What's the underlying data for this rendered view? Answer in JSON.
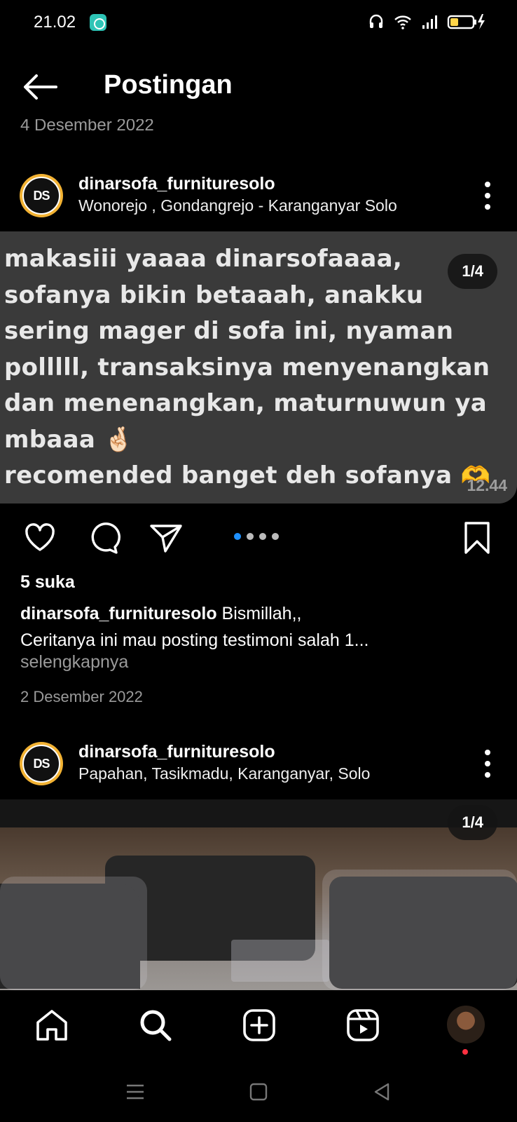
{
  "status_bar": {
    "time": "21.02"
  },
  "header": {
    "title": "Postingan"
  },
  "previous_post_date": "4 Desember 2022",
  "posts": [
    {
      "username": "dinarsofa_furnituresolo",
      "location": "Wonorejo , Gondangrejo - Karanganyar Solo",
      "avatar_text": "DS",
      "image_text": "makasiii yaaaa dinarsofaaaa, sofanya bikin betaaah, anakku sering mager di sofa ini, nyaman polllll, transaksinya menyenangkan dan menenangkan, maturnuwun ya mbaaa 🤞🏻\nrecomended banget deh sofanya 🫶",
      "image_timestamp": "12.44",
      "counter": "1/4",
      "likes": "5 suka",
      "caption_user": "dinarsofa_furnituresolo",
      "caption_line1": " Bismillah,,",
      "caption_line2": "Ceritanya ini mau posting testimoni salah 1...",
      "more_label": "selengkapnya",
      "date": "2 Desember 2022"
    },
    {
      "username": "dinarsofa_furnituresolo",
      "location": "Papahan, Tasikmadu, Karanganyar, Solo",
      "avatar_text": "DS",
      "counter": "1/4"
    }
  ],
  "icons": {
    "back": "arrow-left-icon",
    "like": "heart-icon",
    "comment": "comment-icon",
    "share": "send-icon",
    "save": "bookmark-icon",
    "more": "more-vertical-icon",
    "nav": [
      "home-icon",
      "search-icon",
      "add-post-icon",
      "reels-icon",
      "profile-avatar"
    ]
  },
  "colors": {
    "background": "#000000",
    "accent_dot": "#1e90ff",
    "avatar_ring": "#f2b233",
    "notification": "#ff3040"
  }
}
